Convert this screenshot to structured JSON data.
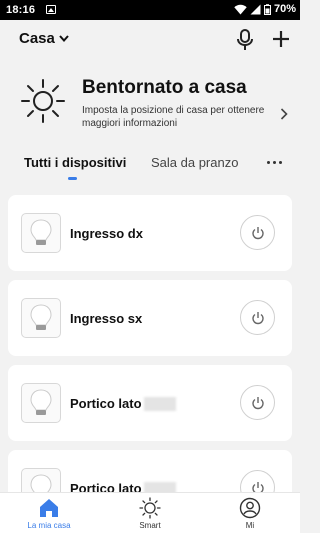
{
  "status_bar": {
    "time": "18:16",
    "battery": "70%"
  },
  "header": {
    "home_name": "Casa"
  },
  "welcome": {
    "title": "Bentornato a casa",
    "subtitle": "Imposta la posizione di casa per ottenere maggiori informazioni"
  },
  "tabs": [
    {
      "label": "Tutti i dispositivi",
      "active": true
    },
    {
      "label": "Sala da pranzo",
      "active": false
    }
  ],
  "devices": [
    {
      "name": "Ingresso dx"
    },
    {
      "name": "Ingresso sx"
    },
    {
      "name": "Portico lato"
    },
    {
      "name": "Portico lato"
    }
  ],
  "bottom_nav": [
    {
      "label": "La mia casa",
      "icon": "home-icon",
      "active": true
    },
    {
      "label": "Smart",
      "icon": "sun-icon",
      "active": false
    },
    {
      "label": "Mi",
      "icon": "profile-icon",
      "active": false
    }
  ],
  "colors": {
    "accent": "#3a7de8",
    "background": "#f2f2f2",
    "card": "#ffffff"
  }
}
